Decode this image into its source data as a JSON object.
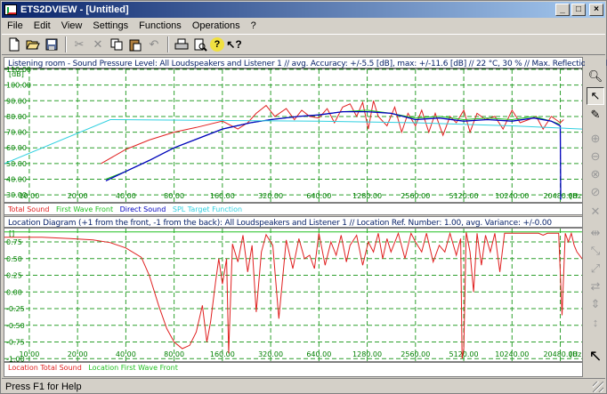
{
  "window": {
    "title": "ETS2DVIEW - [Untitled]"
  },
  "menu": [
    "File",
    "Edit",
    "View",
    "Settings",
    "Functions",
    "Operations",
    "?"
  ],
  "toolbar": [
    "new-icon",
    "open-icon",
    "save-icon",
    "cut-icon",
    "delete-icon",
    "copy-icon",
    "paste-icon",
    "undo-icon",
    "print-icon",
    "print-preview-icon",
    "help-icon",
    "context-help-icon"
  ],
  "spl_panel": {
    "title": "Listening room - Sound Pressure Level:  All Loudspeakers and Listener 1 // avg. Accuracy: +/-5.5 [dB], max: +/-11.6 [dB] // 22 °C, 30 % // Max. Reflection Order: 2",
    "y_unit": "[dB]",
    "y_ticks": [
      "110.00",
      "100.00",
      "90.00",
      "80.00",
      "70.00",
      "60.00",
      "50.00",
      "40.00",
      "30.00"
    ],
    "x_ticks": [
      "10.00",
      "20.00",
      "40.00",
      "80.00",
      "160.00",
      "320.00",
      "640.00",
      "1280.00",
      "2560.00",
      "5120.00",
      "10240.00",
      "20480.00"
    ],
    "x_unit": "[Hz]",
    "legend": [
      {
        "label": "Total Sound",
        "color": "#e02020"
      },
      {
        "label": "First Wave Front",
        "color": "#20c020"
      },
      {
        "label": "Direct Sound",
        "color": "#0000c0"
      },
      {
        "label": "SPL Target Function",
        "color": "#30d0e0"
      }
    ]
  },
  "loc_panel": {
    "title": "Location Diagram (+1 from the front, -1 from the back):  All Loudspeakers and Listener 1 // Location Ref. Number: 1.00, avg. Variance: +/-0.00",
    "y_unit": "[]",
    "y_ticks": [
      "0.75",
      "0.50",
      "0.25",
      "0.00",
      "-0.25",
      "-0.50",
      "-0.75",
      "-1.00"
    ],
    "x_ticks": [
      "10.00",
      "20.00",
      "40.00",
      "80.00",
      "160.00",
      "320.00",
      "640.00",
      "1280.00",
      "2560.00",
      "5120.00",
      "10240.00",
      "20480.00"
    ],
    "x_unit": "[Hz]",
    "legend": [
      {
        "label": "Location Total Sound",
        "color": "#e02020"
      },
      {
        "label": "Location First Wave Front",
        "color": "#20c020"
      }
    ]
  },
  "sidebar": [
    "zoom-icon",
    "select-arrow-icon",
    "pencil-icon",
    "zoom-in-icon",
    "zoom-out-icon",
    "zoom-x-icon",
    "zoom-y-icon",
    "crosshair-icon",
    "expand-x-icon",
    "expand-xy-icon",
    "shrink-xy-icon",
    "shrink-x-icon",
    "expand-y-icon",
    "shrink-y-icon",
    "pointer-icon"
  ],
  "status": {
    "text": "Press F1 for Help"
  },
  "chart_data": [
    {
      "type": "line",
      "title": "Listening room - Sound Pressure Level:  All Loudspeakers and Listener 1 // avg. Accuracy: +/-5.5 [dB], max: +/-11.6 [dB] // 22 °C, 30 % // Max. Reflection Order: 2",
      "xlabel": "[Hz]",
      "ylabel": "[dB]",
      "xscale": "log2",
      "xlim": [
        7,
        28000
      ],
      "ylim": [
        25,
        110
      ],
      "series": [
        {
          "name": "Total Sound",
          "color": "#e02020",
          "x": [
            28,
            40,
            56,
            80,
            110,
            160,
            200,
            230,
            260,
            300,
            340,
            400,
            450,
            500,
            560,
            640,
            720,
            800,
            900,
            1000,
            1100,
            1200,
            1300,
            1400,
            1500,
            1700,
            1900,
            2100,
            2300,
            2560,
            2800,
            3100,
            3400,
            3800,
            4200,
            4600,
            5120,
            5600,
            6200,
            7000,
            8000,
            9000,
            10240,
            11500,
            13000,
            14500,
            16000,
            18000,
            20480,
            21500
          ],
          "y": [
            50,
            59,
            65,
            70,
            73,
            77,
            72,
            76,
            82,
            87,
            80,
            85,
            78,
            84,
            80,
            79,
            85,
            76,
            86,
            88,
            80,
            89,
            72,
            90,
            80,
            74,
            86,
            70,
            82,
            74,
            84,
            70,
            82,
            68,
            80,
            76,
            84,
            70,
            82,
            78,
            80,
            72,
            84,
            76,
            78,
            80,
            72,
            80,
            76,
            78
          ]
        },
        {
          "name": "First Wave Front",
          "color": "#20c020",
          "x": [
            30,
            40,
            56,
            80,
            120,
            160,
            240,
            320,
            480,
            640,
            900,
            1280,
            1800,
            2560,
            3600,
            5120,
            7200,
            10240,
            14000,
            18000,
            20480
          ],
          "y": [
            40,
            45,
            52,
            60,
            67,
            72,
            76,
            78,
            80,
            81,
            83,
            84,
            82,
            79,
            80,
            78,
            79,
            78,
            80,
            77,
            75
          ]
        },
        {
          "name": "Direct Sound",
          "color": "#0000c0",
          "x": [
            30,
            40,
            56,
            80,
            120,
            160,
            240,
            320,
            480,
            640,
            900,
            1280,
            1800,
            2560,
            3600,
            5120,
            7200,
            10240,
            14000,
            18000,
            20480,
            20600
          ],
          "y": [
            39,
            45,
            52,
            60,
            67,
            72,
            76,
            78,
            80,
            81,
            83,
            83,
            82,
            78,
            79,
            77,
            78,
            77,
            79,
            77,
            74,
            27
          ]
        },
        {
          "name": "SPL Target Function",
          "color": "#30d0e0",
          "x": [
            7,
            32,
            640,
            2560,
            10240,
            28000
          ],
          "y": [
            50,
            78,
            77,
            76,
            74,
            72
          ]
        }
      ]
    },
    {
      "type": "line",
      "title": "Location Diagram (+1 from the front, -1 from the back):  All Loudspeakers and Listener 1 // Location Ref. Number: 1.00, avg. Variance: +/-0.00",
      "xlabel": "[Hz]",
      "ylabel": "[]",
      "xscale": "log2",
      "xlim": [
        7,
        28000
      ],
      "ylim": [
        -1.05,
        0.95
      ],
      "series": [
        {
          "name": "Location Total Sound",
          "color": "#e02020",
          "x": [
            7,
            12,
            18,
            25,
            32,
            40,
            50,
            56,
            64,
            72,
            80,
            90,
            100,
            110,
            120,
            128,
            135,
            145,
            152,
            160,
            170,
            175,
            185,
            200,
            215,
            230,
            245,
            260,
            280,
            300,
            330,
            360,
            400,
            440,
            480,
            520,
            560,
            600,
            640,
            700,
            760,
            820,
            880,
            950,
            1000,
            1100,
            1200,
            1300,
            1400,
            1500,
            1600,
            1700,
            1800,
            2000,
            2200,
            2400,
            2560,
            2800,
            3000,
            3300,
            3600,
            3900,
            4200,
            4600,
            4900,
            5000,
            5120,
            5300,
            5600,
            5900,
            6200,
            6600,
            7000,
            7500,
            8000,
            8600,
            9200,
            10240,
            11000,
            12000,
            13000,
            14000,
            15000,
            16000,
            17000,
            18000,
            19000,
            20000,
            21000,
            22000,
            23000,
            24000,
            25000,
            26000,
            28000
          ],
          "y": [
            0.82,
            0.82,
            0.8,
            0.78,
            0.74,
            0.66,
            0.52,
            0.25,
            -0.2,
            -0.55,
            -0.75,
            -0.85,
            -0.8,
            -0.6,
            -0.2,
            -0.75,
            -0.45,
            0.15,
            0.5,
            0.12,
            0.5,
            -0.92,
            0.72,
            0.45,
            0.85,
            0.3,
            0.7,
            -0.3,
            0.6,
            0.86,
            0.7,
            -0.4,
            0.78,
            0.35,
            0.8,
            0.5,
            0.55,
            0.35,
            0.88,
            0.4,
            0.75,
            0.55,
            0.85,
            0.45,
            0.7,
            0.85,
            0.4,
            0.75,
            0.6,
            0.88,
            0.5,
            0.8,
            0.6,
            0.88,
            0.5,
            0.88,
            0.75,
            0.6,
            0.88,
            0.45,
            0.7,
            0.6,
            0.88,
            0.55,
            0.8,
            -1.0,
            -0.85,
            0.9,
            0.6,
            0.0,
            0.88,
            0.4,
            0.85,
            0.6,
            0.88,
            0.3,
            0.88,
            0.88,
            0.88,
            0.88,
            0.88,
            0.88,
            0.88,
            0.85,
            0.88,
            0.88,
            0.88,
            0.88,
            -0.35,
            0.88,
            0.75,
            0.88,
            0.7,
            0.6,
            0.5
          ]
        },
        {
          "name": "Location First Wave Front",
          "color": "#20c020",
          "x": [
            7,
            28000
          ],
          "y": [
            0.9,
            0.9
          ]
        }
      ]
    }
  ]
}
